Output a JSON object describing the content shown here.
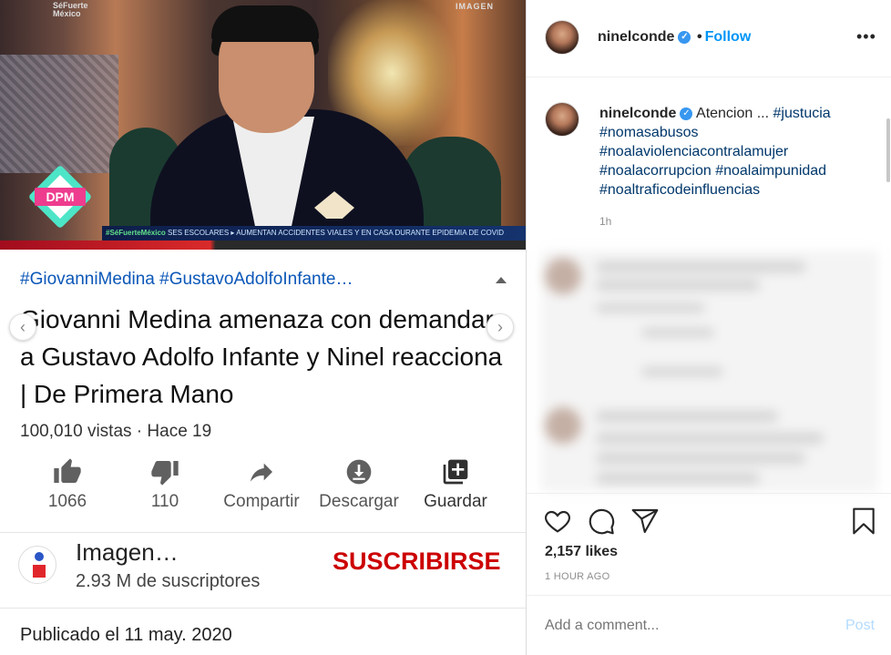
{
  "video": {
    "ticker_tag": "#SéFuerteMéxico",
    "ticker_text": "SES ESCOLARES  ▸ AUMENTAN ACCIDENTES VIALES Y EN CASA DURANTE EPIDEMIA DE COVID",
    "corner_logo_left": "SéFuerte\nMéxico",
    "corner_logo_right": "IMAGEN",
    "badge": "DPM"
  },
  "youtube": {
    "hashtags": "#GiovanniMedina #GustavoAdolfoInfante…",
    "title": "Giovanni Medina amenaza con demandar a Gustavo Adolfo Infante y Ninel reacciona | De Primera Mano",
    "views": "100,010 vistas · Hace 19",
    "actions": {
      "like_count": "1066",
      "dislike_count": "110",
      "share": "Compartir",
      "download": "Descargar",
      "save": "Guardar"
    },
    "channel": {
      "name": "Imagen…",
      "subscribers": "2.93 M de suscriptores",
      "subscribe": "SUSCRIBIRSE"
    },
    "published": "Publicado el 11 may. 2020"
  },
  "instagram": {
    "username": "ninelconde",
    "dot": "•",
    "follow": "Follow",
    "more": "•••",
    "caption": {
      "user": "ninelconde",
      "text": "Atencion ...",
      "hashtags": [
        "#justucia",
        "#nomasabusos",
        "#noalaviolenciacontralamujer",
        "#noalacorrupcion",
        "#noalaimpunidad",
        "#noaltraficodeinfluencias"
      ]
    },
    "caption_time": "1h",
    "likes": "2,157 likes",
    "time_ago": "1 HOUR AGO",
    "comment_placeholder": "Add a comment...",
    "post": "Post"
  },
  "colors": {
    "instagram_blue": "#0095f6",
    "youtube_red": "#cc0000",
    "hashtag_blue": "#0b57b8"
  }
}
